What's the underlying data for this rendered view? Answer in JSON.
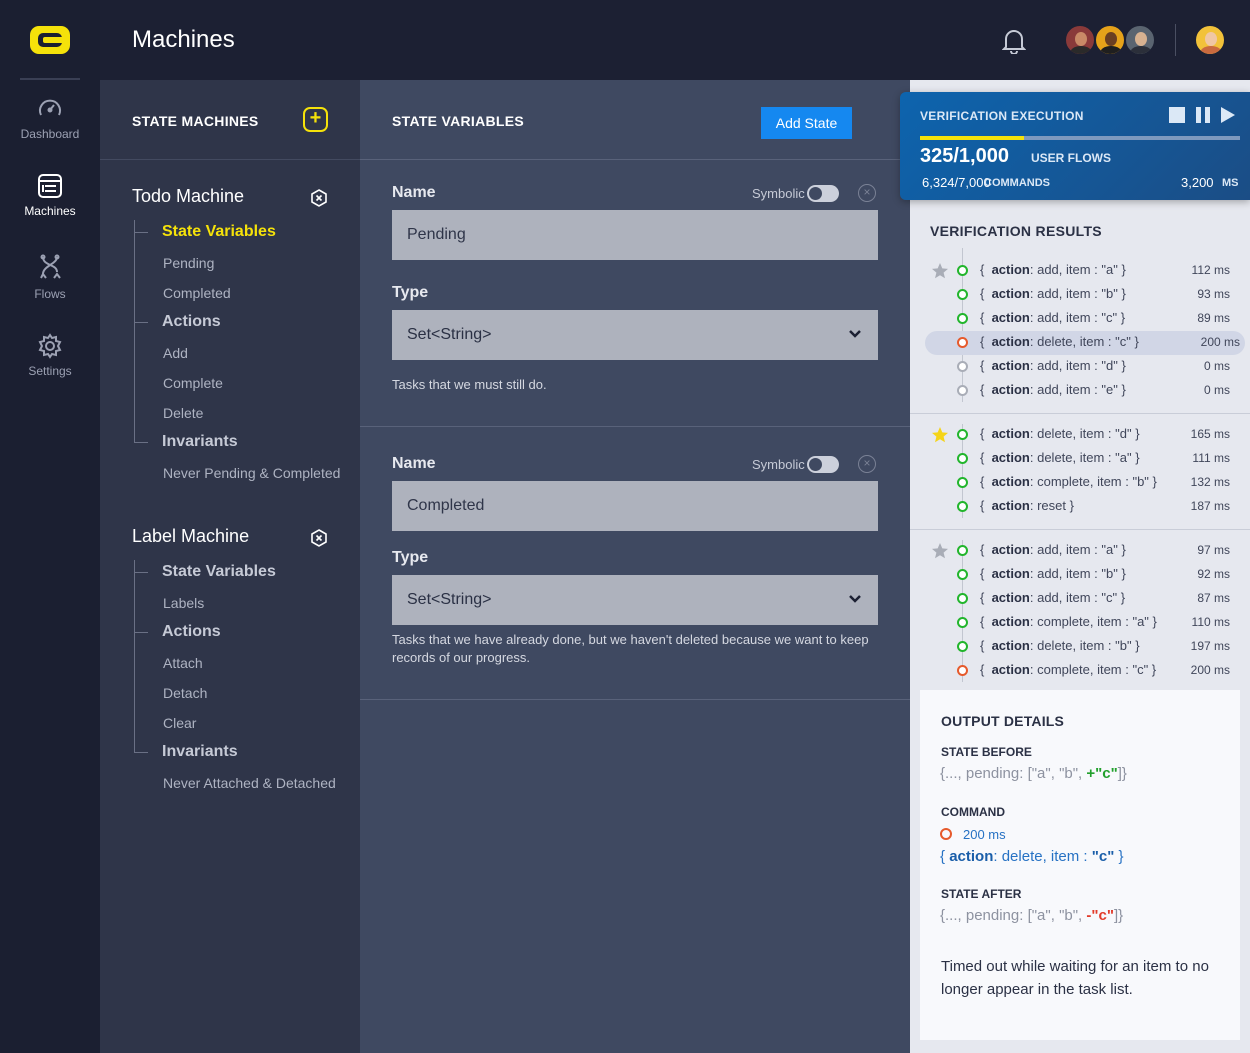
{
  "nav": {
    "items": [
      {
        "label": "Dashboard",
        "icon": "gauge-icon"
      },
      {
        "label": "Machines",
        "icon": "machines-icon",
        "active": true
      },
      {
        "label": "Flows",
        "icon": "flows-icon"
      },
      {
        "label": "Settings",
        "icon": "gear-icon"
      }
    ]
  },
  "header": {
    "title": "Machines"
  },
  "state_machines": {
    "title": "STATE MACHINES",
    "add_icon": "+",
    "todo": {
      "name": "Todo Machine",
      "state_variables": "State Variables",
      "vars": [
        "Pending",
        "Completed"
      ],
      "actions": "Actions",
      "action_items": [
        "Add",
        "Complete",
        "Delete"
      ],
      "invariants": "Invariants",
      "invariant_items": [
        "Never Pending & Completed"
      ]
    },
    "label": {
      "name": "Label Machine",
      "state_variables": "State Variables",
      "vars": [
        "Labels"
      ],
      "actions": "Actions",
      "action_items": [
        "Attach",
        "Detach",
        "Clear"
      ],
      "invariants": "Invariants",
      "invariant_items": [
        "Never Attached & Detached"
      ]
    }
  },
  "state_variables": {
    "title": "STATE VARIABLES",
    "add_button": "Add State",
    "cards": [
      {
        "name_label": "Name",
        "symbolic_label": "Symbolic",
        "name_value": "Pending",
        "type_label": "Type",
        "type_value": "Set<String>",
        "help": "Tasks that we must still do."
      },
      {
        "name_label": "Name",
        "symbolic_label": "Symbolic",
        "name_value": "Completed",
        "type_label": "Type",
        "type_value": "Set<String>",
        "help": "Tasks that we have already done, but we haven't deleted because we want to keep records of our progress."
      }
    ]
  },
  "execution": {
    "title": "VERIFICATION EXECUTION",
    "progress": 0.325,
    "flows": "325/1,000",
    "flows_label": "USER FLOWS",
    "commands": "6,324/7,000",
    "commands_label": "COMMANDS",
    "ms": "3,200",
    "ms_label": "MS"
  },
  "results": {
    "title": "VERIFICATION RESULTS",
    "groups": [
      {
        "starred": false,
        "rows": [
          {
            "status": "pass",
            "key": "action",
            "text": ": add, item : \"a\"  }",
            "ms": "112 ms"
          },
          {
            "status": "pass",
            "key": "action",
            "text": ": add, item : \"b\"  }",
            "ms": "93 ms"
          },
          {
            "status": "pass",
            "key": "action",
            "text": ": add, item : \"c\"  }",
            "ms": "89 ms"
          },
          {
            "status": "fail",
            "key": "action",
            "text": ": delete, item : \"c\"  }",
            "ms": "200 ms",
            "selected": true
          },
          {
            "status": "skip",
            "key": "action",
            "text": ": add, item : \"d\"  }",
            "ms": "0 ms"
          },
          {
            "status": "skip",
            "key": "action",
            "text": ": add, item : \"e\"  }",
            "ms": "0 ms"
          }
        ]
      },
      {
        "starred": true,
        "rows": [
          {
            "status": "pass",
            "key": "action",
            "text": ": delete, item : \"d\"  }",
            "ms": "165 ms"
          },
          {
            "status": "pass",
            "key": "action",
            "text": ": delete, item : \"a\"  }",
            "ms": "111 ms"
          },
          {
            "status": "pass",
            "key": "action",
            "text": ": complete, item : \"b\"  }",
            "ms": "132 ms"
          },
          {
            "status": "pass",
            "key": "action",
            "text": ": reset  }",
            "ms": "187 ms"
          }
        ]
      },
      {
        "starred": false,
        "rows": [
          {
            "status": "pass",
            "key": "action",
            "text": ": add, item : \"a\"  }",
            "ms": "97 ms"
          },
          {
            "status": "pass",
            "key": "action",
            "text": ": add, item : \"b\"  }",
            "ms": "92 ms"
          },
          {
            "status": "pass",
            "key": "action",
            "text": ": add, item : \"c\"  }",
            "ms": "87 ms"
          },
          {
            "status": "pass",
            "key": "action",
            "text": ": complete, item : \"a\"  }",
            "ms": "110 ms"
          },
          {
            "status": "pass",
            "key": "action",
            "text": ": delete, item : \"b\"  }",
            "ms": "197 ms"
          },
          {
            "status": "fail",
            "key": "action",
            "text": ": complete, item : \"c\"  }",
            "ms": "200 ms"
          }
        ]
      }
    ]
  },
  "details": {
    "title": "OUTPUT DETAILS",
    "state_before_label": "STATE BEFORE",
    "state_before_prefix": "{..., pending: [\"a\", \"b\", ",
    "state_before_added": "+\"c\"",
    "state_before_suffix": "]}",
    "command_label": "COMMAND",
    "command_ms": "200 ms",
    "command_open": "{  ",
    "command_key": "action",
    "command_text": ": delete, item : ",
    "command_value": "\"c\"",
    "command_close": "  }",
    "state_after_label": "STATE AFTER",
    "state_after_prefix": "{..., pending: [\"a\", \"b\", ",
    "state_after_removed": "-\"c\"",
    "state_after_suffix": "]}",
    "message": "Timed out while waiting for an item to no longer appear in the task list."
  },
  "colors": {
    "accent_yellow": "#f5e20a",
    "primary_blue": "#1588f0",
    "pass_green": "#22b52c",
    "fail_red": "#e65a2c"
  }
}
